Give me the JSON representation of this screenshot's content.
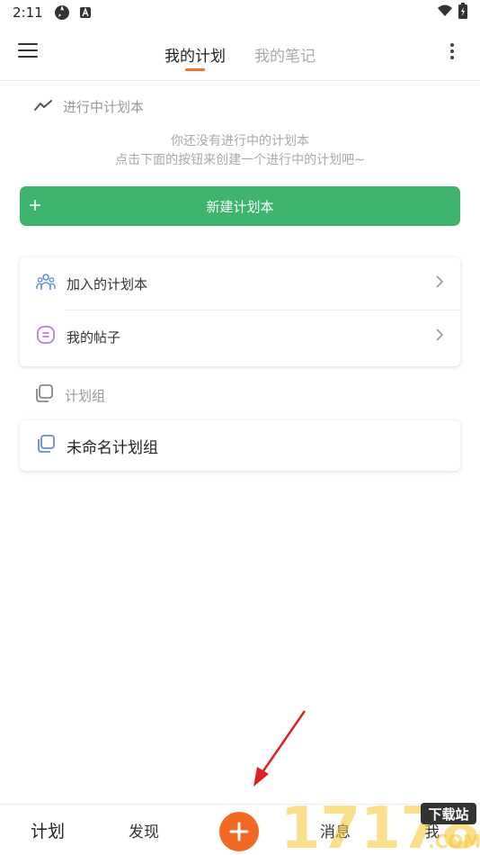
{
  "status_bar": {
    "time": "2:11"
  },
  "header": {
    "tabs": [
      {
        "label": "我的计划",
        "active": true
      },
      {
        "label": "我的笔记",
        "active": false
      }
    ]
  },
  "in_progress": {
    "title": "进行中计划本",
    "empty_line1": "你还没有进行中的计划本",
    "empty_line2": "点击下面的按钮来创建一个进行中的计划吧~",
    "new_button": "新建计划本"
  },
  "menu_card": {
    "items": [
      {
        "label": "加入的计划本",
        "icon": "people-icon"
      },
      {
        "label": "我的帖子",
        "icon": "post-icon"
      }
    ]
  },
  "group_section": {
    "title": "计划组",
    "groups": [
      {
        "label": "未命名计划组"
      }
    ]
  },
  "bottom_nav": {
    "items": [
      "计划",
      "发现",
      "消息",
      "我"
    ]
  },
  "watermark": {
    "number": "17178",
    "text": "下载站",
    "suffix": ".COM"
  },
  "colors": {
    "accent": "#f07030",
    "green": "#3eb46e",
    "fab": "#f06a24",
    "arrow": "#e02020"
  }
}
